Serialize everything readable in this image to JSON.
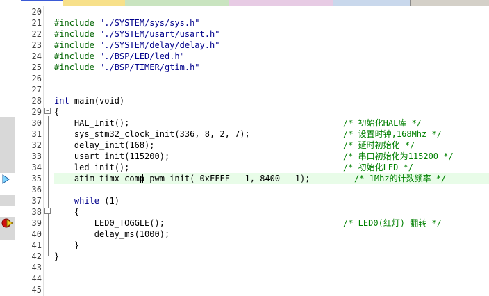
{
  "lines": [
    {
      "n": "20",
      "code": "",
      "comment": ""
    },
    {
      "n": "21",
      "pp": "#include",
      "str": "\"./SYSTEM/sys/sys.h\"",
      "comment": ""
    },
    {
      "n": "22",
      "pp": "#include",
      "str": "\"./SYSTEM/usart/usart.h\"",
      "comment": ""
    },
    {
      "n": "23",
      "pp": "#include",
      "str": "\"./SYSTEM/delay/delay.h\"",
      "comment": ""
    },
    {
      "n": "24",
      "pp": "#include",
      "str": "\"./BSP/LED/led.h\"",
      "comment": ""
    },
    {
      "n": "25",
      "pp": "#include",
      "str": "\"./BSP/TIMER/gtim.h\"",
      "comment": ""
    },
    {
      "n": "26",
      "code": "",
      "comment": ""
    },
    {
      "n": "27",
      "code": "",
      "comment": ""
    },
    {
      "n": "28",
      "kw": "int",
      "code": " main(void)",
      "comment": ""
    },
    {
      "n": "29",
      "code": "{",
      "comment": ""
    },
    {
      "n": "30",
      "code": "    HAL_Init();",
      "comment": "/* 初始化HAL库 */"
    },
    {
      "n": "31",
      "code": "    sys_stm32_clock_init(336, 8, 2, 7);",
      "comment": "/* 设置时钟,168Mhz */"
    },
    {
      "n": "32",
      "code": "    delay_init(168);",
      "comment": "/* 延时初始化 */"
    },
    {
      "n": "33",
      "code": "    usart_init(115200);",
      "comment": "/* 串口初始化为115200 */"
    },
    {
      "n": "34",
      "code": "    led_init();",
      "comment": "/* 初始化LED */"
    },
    {
      "n": "35",
      "code": "    atim_timx_comp_pwm_init( 0xFFFF - 1, 8400 - 1);",
      "comment": "/* 1Mhz的计数频率 */"
    },
    {
      "n": "36",
      "code": "",
      "comment": ""
    },
    {
      "n": "37",
      "kw": "while",
      "indent": "    ",
      "code": " (1)",
      "comment": ""
    },
    {
      "n": "38",
      "code": "    {",
      "comment": ""
    },
    {
      "n": "39",
      "code": "        LED0_TOGGLE();",
      "comment": "/* LED0(红灯) 翻转 */"
    },
    {
      "n": "40",
      "code": "        delay_ms(1000);",
      "comment": ""
    },
    {
      "n": "41",
      "code": "    }",
      "comment": ""
    },
    {
      "n": "42",
      "code": "}",
      "comment": ""
    },
    {
      "n": "43",
      "code": "",
      "comment": ""
    },
    {
      "n": "44",
      "code": "",
      "comment": ""
    },
    {
      "n": "45",
      "code": "",
      "comment": ""
    }
  ],
  "colors": {
    "preprocessor": "#006400",
    "string": "#00008b",
    "keyword": "#00008b",
    "comment": "#008000",
    "current_line": "#e8fce8"
  },
  "icons": {
    "exec_arrow": "current-line-arrow-icon",
    "breakpoint": "breakpoint-icon"
  }
}
